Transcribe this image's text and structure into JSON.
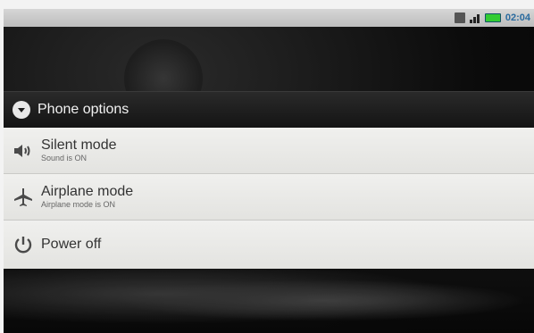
{
  "status_bar": {
    "time": "02:04",
    "icons": [
      "sd-card-icon",
      "signal-icon",
      "battery-icon"
    ]
  },
  "dialog": {
    "title": "Phone options",
    "options": [
      {
        "label": "Silent mode",
        "summary": "Sound is ON",
        "icon": "speaker-icon"
      },
      {
        "label": "Airplane mode",
        "summary": "Airplane mode is ON",
        "icon": "airplane-icon"
      },
      {
        "label": "Power off",
        "summary": "",
        "icon": "power-icon"
      }
    ]
  },
  "colors": {
    "time_text": "#2a6b9f",
    "header_bg": "#1c1c1c",
    "options_bg": "#e9e9e6"
  }
}
